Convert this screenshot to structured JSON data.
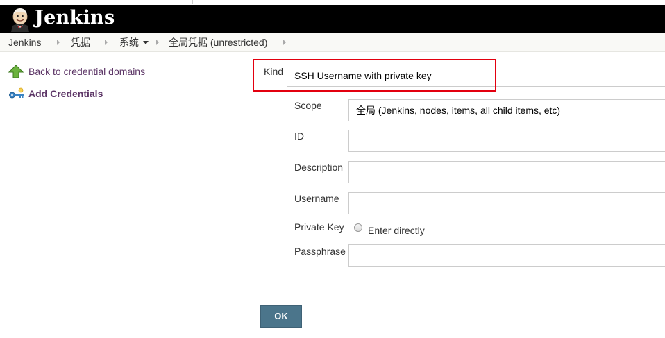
{
  "header": {
    "brand": "Jenkins"
  },
  "breadcrumb": {
    "items": [
      "Jenkins",
      "凭据",
      "系统",
      "全局凭据 (unrestricted)"
    ]
  },
  "sidebar": {
    "items": [
      {
        "label": "Back to credential domains",
        "icon": "up-arrow-icon"
      },
      {
        "label": "Add Credentials",
        "icon": "key-icon"
      }
    ]
  },
  "form": {
    "kind": {
      "label": "Kind",
      "value": "SSH Username with private key"
    },
    "scope": {
      "label": "Scope",
      "value": "全局 (Jenkins, nodes, items, all child items, etc)"
    },
    "id": {
      "label": "ID",
      "value": ""
    },
    "description": {
      "label": "Description",
      "value": ""
    },
    "username": {
      "label": "Username",
      "value": ""
    },
    "private_key": {
      "label": "Private Key",
      "option": "Enter directly"
    },
    "passphrase": {
      "label": "Passphrase",
      "value": ""
    },
    "ok_label": "OK"
  },
  "colors": {
    "header_bg": "#000000",
    "link": "#5c3566",
    "button": "#4b758b",
    "highlight": "#e3000f"
  }
}
